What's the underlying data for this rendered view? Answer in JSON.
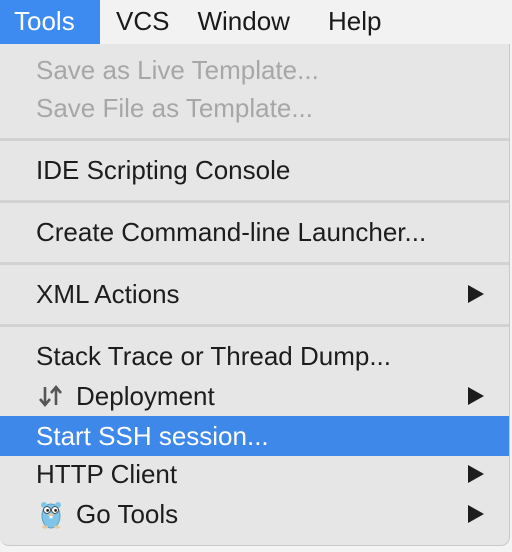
{
  "menubar": {
    "items": [
      {
        "label": "Tools"
      },
      {
        "label": "VCS"
      },
      {
        "label": "Window"
      },
      {
        "label": "Help"
      }
    ],
    "active_index": 0
  },
  "dropdown": {
    "items": [
      {
        "label": "Save as Live Template...",
        "enabled": false
      },
      {
        "label": "Save File as Template...",
        "enabled": false
      },
      {
        "label": "IDE Scripting Console",
        "enabled": true
      },
      {
        "label": "Create Command-line Launcher...",
        "enabled": true
      },
      {
        "label": "XML Actions",
        "enabled": true,
        "submenu": true
      },
      {
        "label": "Stack Trace or Thread Dump...",
        "enabled": true
      },
      {
        "label": "Deployment",
        "enabled": true,
        "submenu": true,
        "icon": "up-down-arrows-icon"
      },
      {
        "label": "Start SSH session...",
        "enabled": true,
        "highlighted": true
      },
      {
        "label": "HTTP Client",
        "enabled": true,
        "submenu": true
      },
      {
        "label": "Go Tools",
        "enabled": true,
        "submenu": true,
        "icon": "gopher-icon"
      }
    ]
  },
  "colors": {
    "menubar_active": "#3d8bf1",
    "highlight": "#3e88ea",
    "disabled_text": "#a7a7a7",
    "menu_background": "#e6e6e6"
  }
}
